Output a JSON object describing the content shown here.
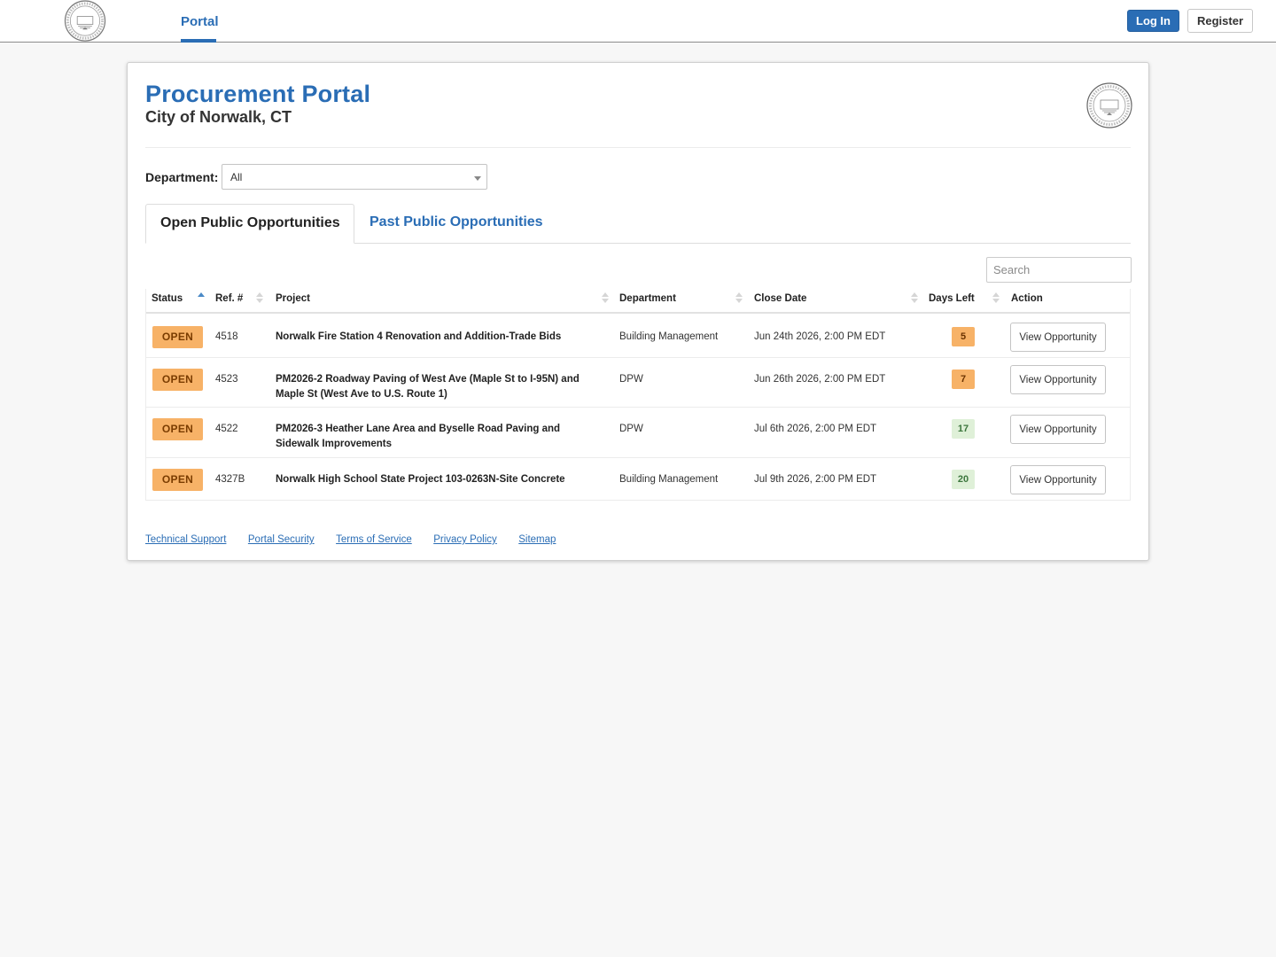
{
  "nav": {
    "portal_label": "Portal",
    "login_label": "Log In",
    "register_label": "Register"
  },
  "header": {
    "title": "Procurement Portal",
    "subtitle": "City of Norwalk, CT"
  },
  "filter": {
    "department_label": "Department:",
    "department_value": "All"
  },
  "tabs": {
    "open_label": "Open Public Opportunities",
    "past_label": "Past Public Opportunities"
  },
  "search": {
    "placeholder": "Search"
  },
  "table": {
    "headers": {
      "status": "Status",
      "ref": "Ref. #",
      "project": "Project",
      "department": "Department",
      "close_date": "Close Date",
      "days_left": "Days Left",
      "action": "Action"
    },
    "rows": [
      {
        "status": "OPEN",
        "ref": "4518",
        "project": "Norwalk Fire Station 4 Renovation and Addition-Trade Bids",
        "department": "Building Management",
        "close_date": "Jun 24th 2026, 2:00 PM EDT",
        "days_left": "5",
        "action": "View Opportunity"
      },
      {
        "status": "OPEN",
        "ref": "4523",
        "project": "PM2026-2 Roadway Paving of West Ave (Maple St to I-95N) and Maple St (West Ave to U.S. Route 1)",
        "department": "DPW",
        "close_date": "Jun 26th 2026, 2:00 PM EDT",
        "days_left": "7",
        "action": "View Opportunity"
      },
      {
        "status": "OPEN",
        "ref": "4522",
        "project": "PM2026-3 Heather Lane Area and Byselle Road Paving and Sidewalk Improvements",
        "department": "DPW",
        "close_date": "Jul 6th 2026, 2:00 PM EDT",
        "days_left": "17",
        "action": "View Opportunity"
      },
      {
        "status": "OPEN",
        "ref": "4327B",
        "project": "Norwalk High School State Project 103-0263N-Site Concrete",
        "department": "Building Management",
        "close_date": "Jul 9th 2026, 2:00 PM EDT",
        "days_left": "20",
        "action": "View Opportunity"
      }
    ]
  },
  "footer": {
    "links": [
      "Technical Support",
      "Portal Security",
      "Terms of Service",
      "Privacy Policy",
      "Sitemap"
    ]
  },
  "icons": {
    "seal": "city-seal-icon",
    "sort": "sort-arrows-icon",
    "caret": "chevron-down-icon"
  },
  "colors": {
    "accent": "#2a6db5",
    "open_badge": "#f7b267",
    "days_soon": "#f7b267",
    "days_later": "#dff0d8"
  }
}
